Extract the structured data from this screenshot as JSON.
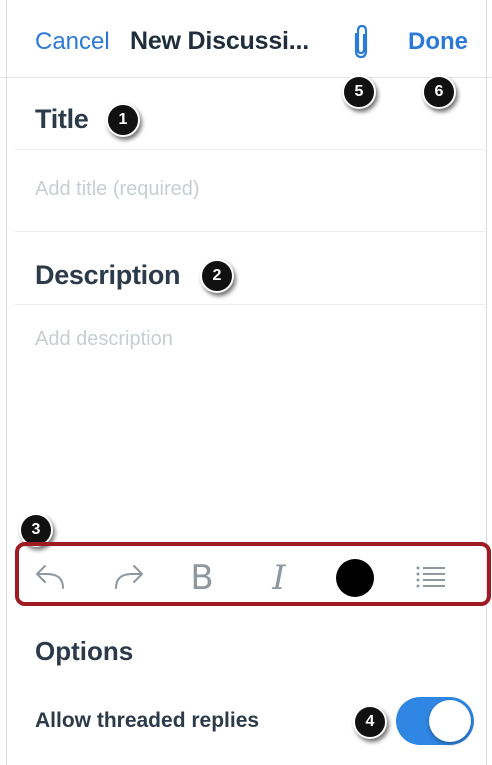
{
  "nav": {
    "cancel_label": "Cancel",
    "title": "New Discussi...",
    "attach_icon": "paperclip-icon",
    "done_label": "Done"
  },
  "title_section": {
    "heading": "Title",
    "placeholder": "Add title (required)"
  },
  "description_section": {
    "heading": "Description",
    "placeholder": "Add description"
  },
  "toolbar": {
    "items": [
      {
        "name": "undo-icon"
      },
      {
        "name": "redo-icon"
      },
      {
        "name": "bold-button",
        "label": "B"
      },
      {
        "name": "italic-button",
        "label": "I"
      },
      {
        "name": "text-color-button",
        "color": "#000000"
      },
      {
        "name": "bulleted-list-icon"
      }
    ],
    "highlight_color": "#9e1b24"
  },
  "options": {
    "heading": "Options",
    "threaded_replies_label": "Allow threaded replies",
    "threaded_replies_enabled": true
  },
  "callouts": {
    "c1": "1",
    "c2": "2",
    "c3": "3",
    "c4": "4",
    "c5": "5",
    "c6": "6"
  },
  "colors": {
    "accent": "#2b7bd6",
    "toggle_on": "#2f86e3"
  }
}
